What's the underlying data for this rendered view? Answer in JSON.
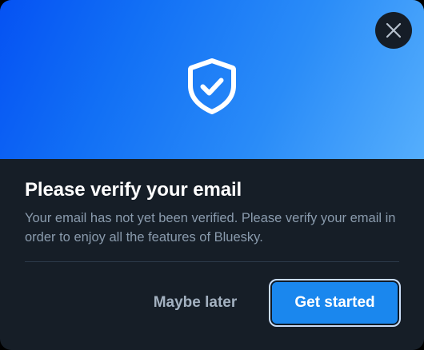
{
  "dialog": {
    "title": "Please verify your email",
    "description": "Your email has not yet been verified. Please verify your email in order to enjoy all the features of Bluesky.",
    "hero_icon": "shield-check-icon",
    "close_icon": "close-icon"
  },
  "actions": {
    "secondary_label": "Maybe later",
    "primary_label": "Get started"
  },
  "colors": {
    "accent": "#1a87ee",
    "background": "#161e27",
    "gradient_start": "#0552f3",
    "gradient_end": "#55aefc"
  }
}
